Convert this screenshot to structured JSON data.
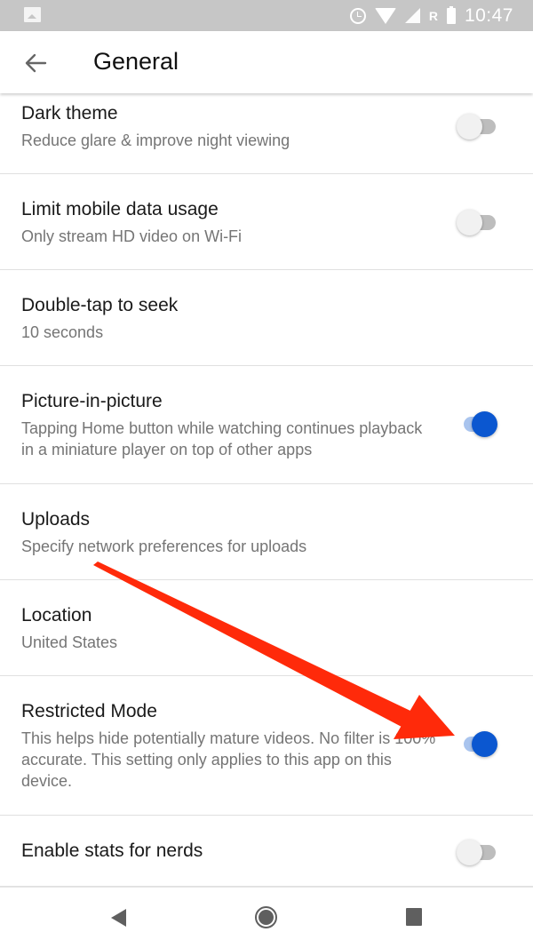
{
  "status_bar": {
    "icons": [
      "photo-icon",
      "alarm-icon",
      "wifi-icon",
      "signal-icon",
      "battery-icon"
    ],
    "roaming_indicator": "R",
    "time": "10:47"
  },
  "app_bar": {
    "back_icon": "arrow-left-icon",
    "title": "General"
  },
  "settings": [
    {
      "title": "Dark theme",
      "description": "Reduce glare & improve night viewing",
      "toggle": false
    },
    {
      "title": "Limit mobile data usage",
      "description": "Only stream HD video on Wi-Fi",
      "toggle": false
    },
    {
      "title": "Double-tap to seek",
      "description": "10 seconds",
      "toggle": null
    },
    {
      "title": "Picture-in-picture",
      "description": "Tapping Home button while watching continues playback in a miniature player on top of other apps",
      "toggle": true
    },
    {
      "title": "Uploads",
      "description": "Specify network preferences for uploads",
      "toggle": null
    },
    {
      "title": "Location",
      "description": "United States",
      "toggle": null
    },
    {
      "title": "Restricted Mode",
      "description": "This helps hide potentially mature videos. No filter is 100% accurate. This setting only applies to this app on this device.",
      "toggle": true
    },
    {
      "title": "Enable stats for nerds",
      "description": "",
      "toggle": false
    }
  ],
  "nav_bar": {
    "icons": [
      "nav-back-icon",
      "nav-home-icon",
      "nav-recents-icon"
    ]
  },
  "annotation": {
    "type": "arrow",
    "color": "#ff2a0a",
    "points_to": "Restricted Mode toggle"
  },
  "colors": {
    "accent": "#0b57d0",
    "toggle_on_track": "#a9c4ee",
    "toggle_off_track": "#bdbdbd",
    "status_bar": "#c6c6c6"
  }
}
